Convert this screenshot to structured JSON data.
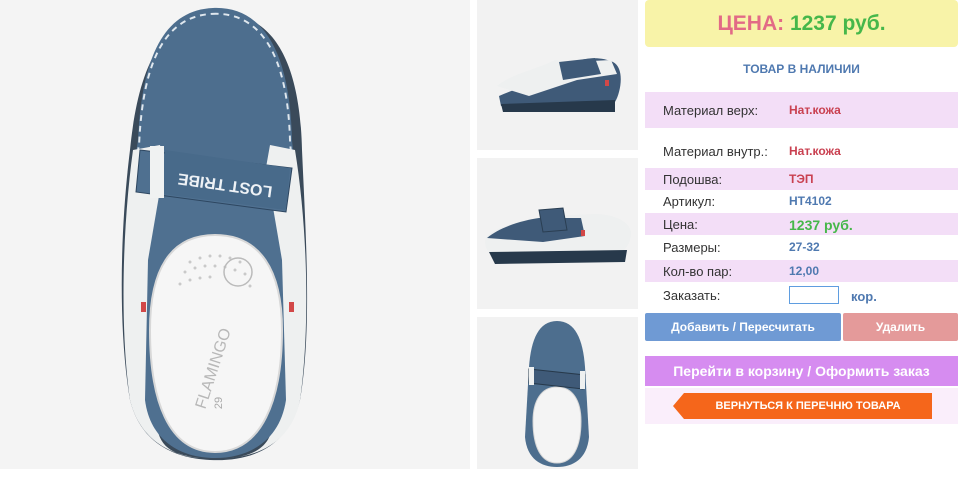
{
  "price_box": {
    "label": "ЦЕНА:",
    "value": "1237 руб."
  },
  "stock_status": "ТОВАР В НАЛИЧИИ",
  "details": {
    "material_top": {
      "label": "Материал верх:",
      "value": "Нат.кожа"
    },
    "material_inner": {
      "label": "Материал внутр.:",
      "value": "Нат.кожа"
    },
    "sole": {
      "label": "Подошва:",
      "value": "ТЭП"
    },
    "article": {
      "label": "Артикул:",
      "value": "HT4102"
    },
    "price": {
      "label": "Цена:",
      "value": "1237 руб."
    },
    "sizes": {
      "label": "Размеры:",
      "value": "27-32"
    },
    "pairs": {
      "label": "Кол-во пар:",
      "value": "12,00"
    },
    "order": {
      "label": "Заказать:",
      "value": "",
      "unit": "кор."
    }
  },
  "buttons": {
    "add": "Добавить / Пересчитать",
    "delete": "Удалить",
    "go_to_cart": "Перейти в корзину / Оформить заказ",
    "back": "ВЕРНУТЬСЯ К ПЕРЕЧНЮ ТОВАРА"
  },
  "product_print": {
    "strap_text": "LOST TRIBE",
    "insole_brand": "FLAMINGO",
    "insole_size": "29"
  },
  "colors": {
    "price_bg": "#f8f3a8",
    "highlight_row": "#f3def7",
    "cart_button": "#d68cf0",
    "back_button": "#f5661b",
    "add_button": "#6f9ad4",
    "delete_button": "#e49a9a"
  }
}
